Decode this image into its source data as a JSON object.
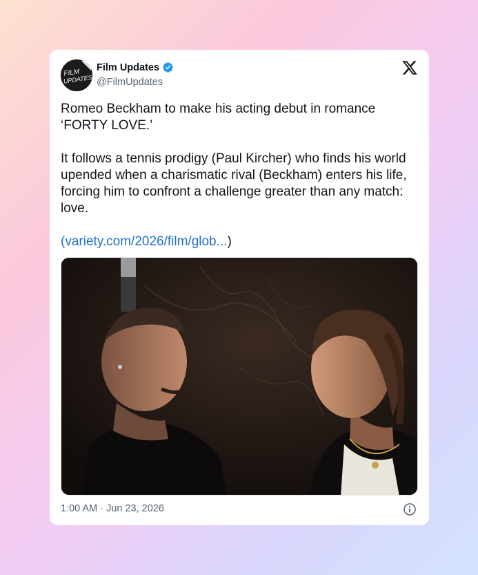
{
  "author": {
    "display_name": "Film Updates",
    "handle": "@FilmUpdates",
    "avatar_text_line1": "FILM",
    "avatar_text_line2": "UPDATES",
    "verified_icon": "verified-badge-icon"
  },
  "tweet": {
    "headline": "Romeo Beckham to make his acting debut in romance ‘FORTY LOVE.’",
    "body": "It follows a tennis prodigy (Paul Kircher) who finds his world upended when a charismatic rival (Beckham) enters his life, forcing him to confront a challenge greater than any match: love.",
    "link_open": "(",
    "link_text": "variety.com/2026/film/glob...",
    "link_close": ")"
  },
  "media": {
    "description_icon": "photo-two-men-facing-each-other"
  },
  "footer": {
    "timestamp": "1:00 AM · Jun 23, 2026",
    "info_icon": "info-icon"
  },
  "colors": {
    "link": "#1d6fd0",
    "verified": "#1d9bf0",
    "text": "#0f1419",
    "secondary_text": "#536471"
  }
}
